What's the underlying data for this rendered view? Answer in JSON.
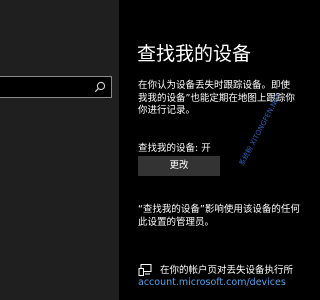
{
  "sidebar": {
    "search": {
      "placeholder": "",
      "icon": "search-icon"
    }
  },
  "main": {
    "title": "查找我的设备",
    "description_lines": [
      "在你认为设备丢失时跟踪设备。即使",
      "我我的设备”也能定期在地图上跟踪你",
      "你进行记录。"
    ],
    "status": "查找我的设备: 开",
    "change_button": "更改",
    "watermark": "系统粉 XITONGFEN.NET",
    "policy_lines": [
      "“查找我的设备”影响使用该设备的任何",
      "此设置的管理员。"
    ],
    "device_row": {
      "text": "在你的帐户页对丢失设备执行所",
      "link": "account.microsoft.com/devices",
      "icon": "devices-icon"
    }
  },
  "colors": {
    "background": "#000000",
    "sidebar": "#1f1f1f",
    "button": "#333333",
    "link": "#5aa0e8",
    "watermark": "#3b6fd6"
  }
}
